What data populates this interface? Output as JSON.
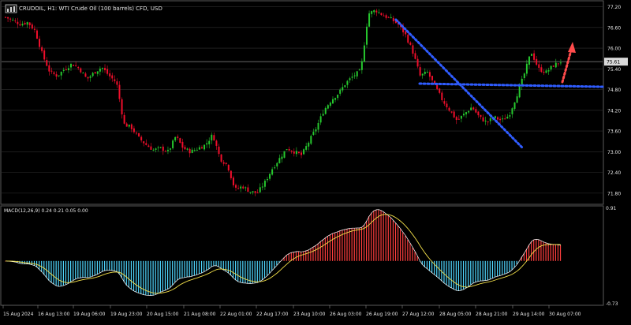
{
  "colors": {
    "bull": "#26c72e",
    "bear": "#f00e2b",
    "macd_pos": "#ff3e3e",
    "macd_neg": "#4fd7ff",
    "signal": "#f3e04a",
    "macd_line": "#ffffff",
    "grid": "#2f2f2f",
    "current_line": "#8a8a8a",
    "blue_annot": "#2f5cff",
    "red_annot": "#ff4b4b"
  },
  "main": {
    "title_text": "CRUDOIL, H1:  WTI Crude Oil (100 barrels) CFD, USD",
    "price_axis": {
      "ticks": [
        "77.20",
        "76.60",
        "76.00",
        "75.40",
        "74.80",
        "74.20",
        "73.60",
        "73.00",
        "72.40",
        "71.80"
      ],
      "current_price_label": "75.61"
    }
  },
  "indicator": {
    "label": "MACD(12,26,9) 0.24 0.21 0.05 0.00",
    "axis_top": "0.91",
    "axis_bottom": "-0.73"
  },
  "time_axis": {
    "labels": [
      "15 Aug 2024",
      "16 Aug 13:00",
      "19 Aug 06:00",
      "19 Aug 23:00",
      "20 Aug 15:00",
      "21 Aug 08:00",
      "22 Aug 01:00",
      "22 Aug 17:00",
      "23 Aug 10:00",
      "26 Aug 03:00",
      "26 Aug 19:00",
      "27 Aug 12:00",
      "28 Aug 05:00",
      "28 Aug 21:00",
      "29 Aug 14:00",
      "30 Aug 07:00"
    ]
  },
  "icons": {
    "app_icon": "chart-icon"
  },
  "chart_data": {
    "type": "candlestick",
    "title": "CRUDOIL, H1:  WTI Crude Oil (100 barrels) CFD, USD",
    "y_axis_ticks": [
      77.2,
      76.6,
      76.0,
      75.4,
      74.8,
      74.2,
      73.6,
      73.0,
      72.4,
      71.8
    ],
    "ylim": [
      71.5,
      77.35
    ],
    "current_price": 75.61,
    "x_labels": [
      "15 Aug 2024",
      "16 Aug 13:00",
      "19 Aug 06:00",
      "19 Aug 23:00",
      "20 Aug 15:00",
      "21 Aug 08:00",
      "22 Aug 01:00",
      "22 Aug 17:00",
      "23 Aug 10:00",
      "26 Aug 03:00",
      "26 Aug 19:00",
      "27 Aug 12:00",
      "28 Aug 05:00",
      "28 Aug 21:00",
      "29 Aug 14:00",
      "30 Aug 07:00"
    ],
    "closes_approx": [
      76.9,
      76.8,
      76.7,
      76.75,
      76.5,
      75.8,
      75.3,
      75.2,
      75.4,
      75.55,
      75.4,
      75.1,
      75.3,
      75.45,
      75.2,
      75.0,
      73.8,
      73.7,
      73.4,
      73.2,
      73.05,
      73.1,
      73.0,
      73.45,
      73.1,
      73.0,
      73.1,
      73.2,
      73.5,
      72.8,
      72.6,
      71.9,
      72.0,
      71.85,
      71.8,
      72.1,
      72.5,
      72.8,
      73.1,
      73.0,
      72.9,
      73.3,
      73.7,
      74.2,
      74.5,
      74.7,
      75.0,
      75.2,
      75.35,
      77.0,
      77.1,
      76.95,
      76.85,
      76.7,
      76.4,
      75.9,
      75.2,
      75.3,
      74.9,
      74.5,
      74.2,
      73.9,
      74.1,
      74.3,
      74.0,
      73.85,
      74.0,
      73.9,
      74.05,
      74.6,
      75.2,
      75.9,
      75.4,
      75.3,
      75.5,
      75.61
    ],
    "indicator": {
      "name": "MACD",
      "params": "12,26,9",
      "printed_values": [
        0.24,
        0.21,
        0.05,
        0.0
      ],
      "ylim": [
        -0.73,
        0.91
      ]
    }
  }
}
